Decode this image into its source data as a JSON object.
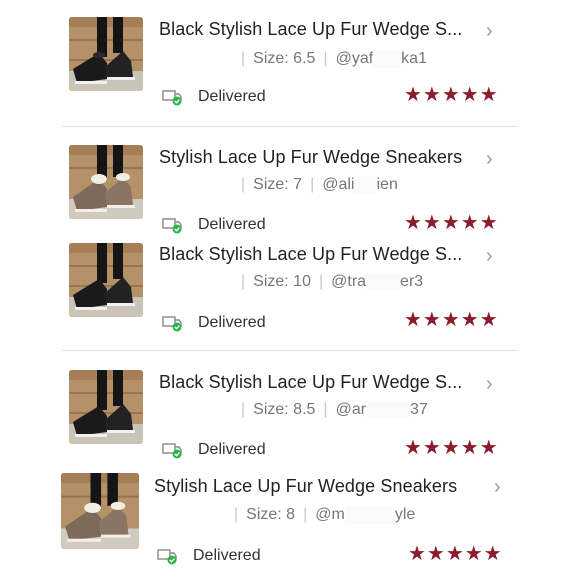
{
  "orders": [
    {
      "title": "Black Stylish Lace Up Fur Wedge S...",
      "size": "Size: 6.5",
      "user": "@yaf",
      "user_tail": "ka1",
      "status": "Delivered",
      "rating": "★★★★★",
      "variant": "black"
    },
    {
      "title": "Stylish Lace Up Fur Wedge Sneakers",
      "size": "Size: 7",
      "user": "@ali",
      "user_tail": "ien",
      "status": "Delivered",
      "rating": "★★★★★",
      "variant": "brown"
    },
    {
      "title": "Black Stylish Lace Up Fur Wedge S...",
      "size": "Size: 10",
      "user": "@tra",
      "user_tail": "er3",
      "status": "Delivered",
      "rating": "★★★★★",
      "variant": "black"
    },
    {
      "title": "Black Stylish Lace Up Fur Wedge S...",
      "size": "Size: 8.5",
      "user": "@ar",
      "user_tail": "37",
      "status": "Delivered",
      "rating": "★★★★★",
      "variant": "black"
    },
    {
      "title": "Stylish Lace Up Fur Wedge Sneakers",
      "size": "Size: 8",
      "user": "@m",
      "user_tail": "yle",
      "status": "Delivered",
      "rating": "★★★★★",
      "variant": "brown"
    }
  ],
  "colors": {
    "star": "#8a1c2b",
    "check": "#2db34a",
    "chevron": "#9a9a9a"
  },
  "icons": {
    "chevron": "chevron-right-icon",
    "status": "delivery-truck-check-icon",
    "rating": "star-icon"
  }
}
